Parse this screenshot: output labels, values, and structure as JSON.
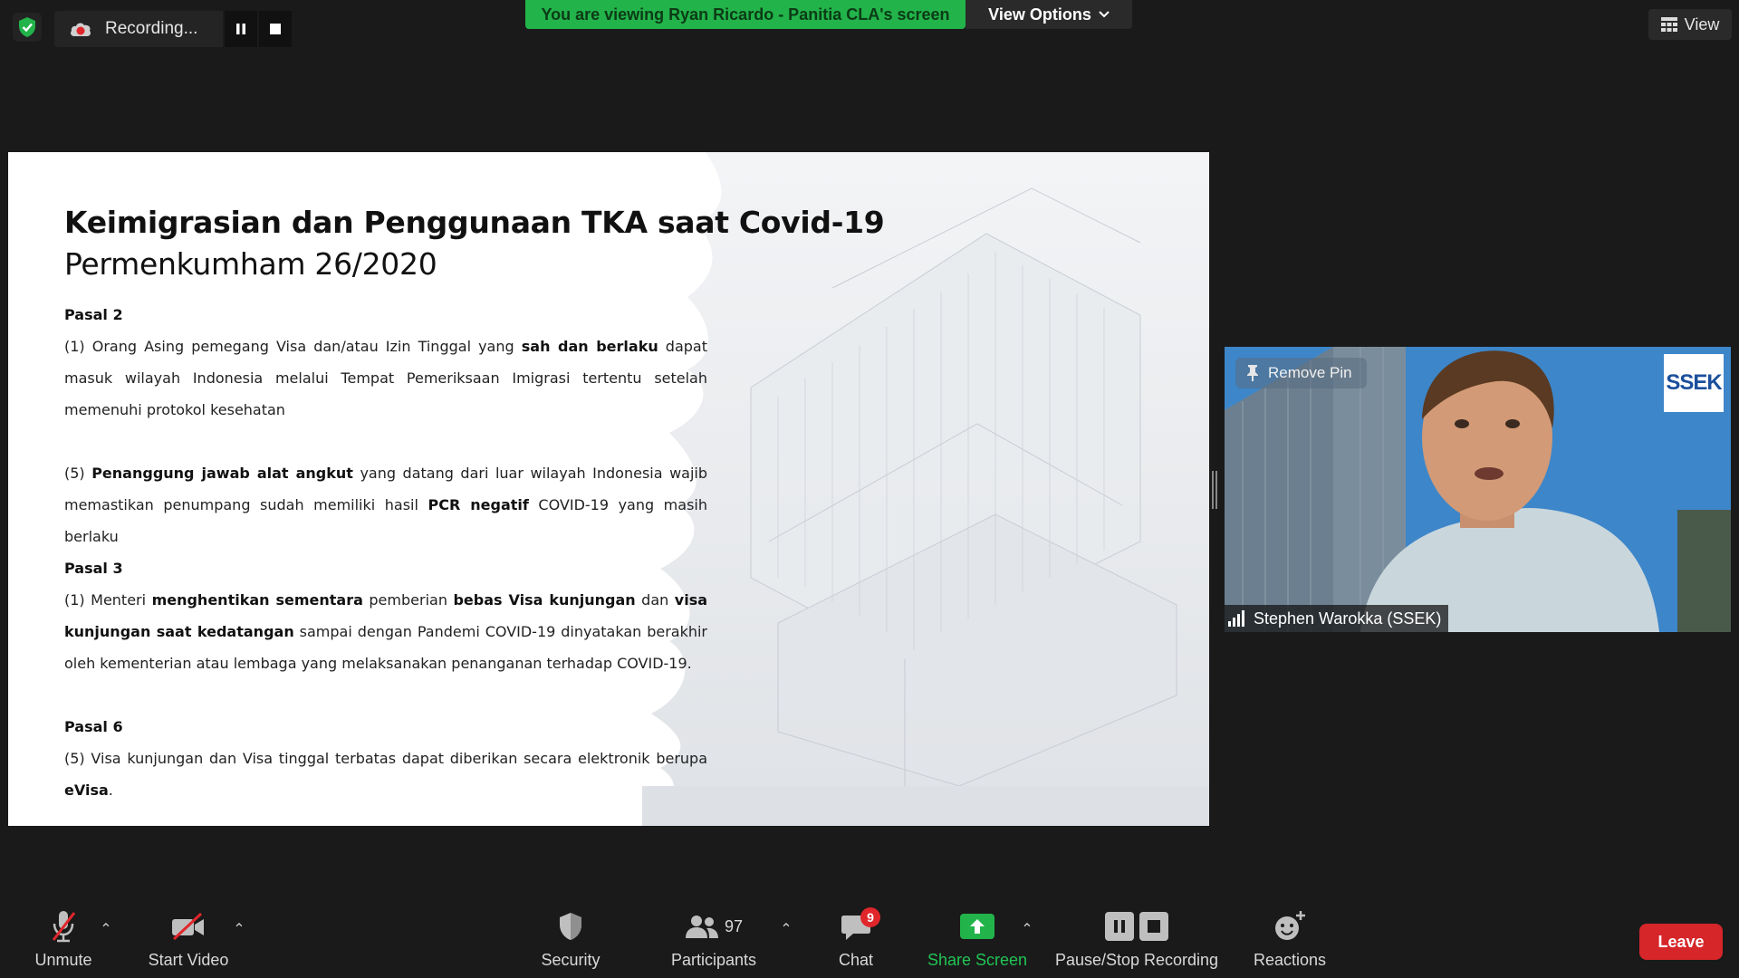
{
  "topbar": {
    "recording_label": "Recording...",
    "viewing_banner": "You are viewing Ryan Ricardo - Panitia CLA's screen",
    "view_options_label": "View Options",
    "view_label": "View"
  },
  "slide": {
    "title": "Keimigrasian dan Penggunaan TKA saat Covid-19",
    "subtitle": "Permenkumham 26/2020",
    "sections": [
      {
        "heading": "Pasal 2",
        "para1": {
          "t1": "(1) Orang Asing pemegang Visa dan/atau Izin Tinggal yang ",
          "b1": "sah dan berlaku",
          "t2": " dapat masuk wilayah Indonesia melalui Tempat Pemeriksaan Imigrasi tertentu setelah memenuhi protokol kesehatan"
        },
        "para2": {
          "t1": "(5) ",
          "b1": "Penanggung jawab alat angkut",
          "t2": " yang datang dari luar wilayah Indonesia wajib memastikan penumpang sudah memiliki hasil ",
          "b2": "PCR negatif",
          "t3": " COVID-19 yang masih berlaku"
        }
      },
      {
        "heading": "Pasal 3",
        "para1": {
          "t1": "(1) Menteri ",
          "b1": "menghentikan sementara",
          "t2": " pemberian ",
          "b2": "bebas Visa kunjungan",
          "t3": " dan ",
          "b3": "visa kunjungan saat kedatangan",
          "t4": " sampai dengan Pandemi COVID-19 dinyatakan berakhir oleh kementerian atau lembaga yang melaksanakan penanganan terhadap COVID-19."
        }
      },
      {
        "heading": "Pasal 6",
        "para1": {
          "t1": "(5) Visa kunjungan dan Visa tinggal terbatas dapat diberikan secara elektronik berupa ",
          "b1": "eVisa",
          "t2": "."
        }
      }
    ]
  },
  "video": {
    "remove_pin_label": "Remove Pin",
    "participant_name": "Stephen Warokka (SSEK)",
    "logo_text": "SSEK"
  },
  "toolbar": {
    "unmute_label": "Unmute",
    "start_video_label": "Start Video",
    "security_label": "Security",
    "participants_label": "Participants",
    "participants_count": "97",
    "chat_label": "Chat",
    "chat_badge": "9",
    "share_screen_label": "Share Screen",
    "pause_stop_label": "Pause/Stop Recording",
    "reactions_label": "Reactions",
    "leave_label": "Leave"
  },
  "colors": {
    "green_banner": "#22b34a",
    "leave_red": "#d6262a",
    "share_green": "#22b34a"
  },
  "icons": [
    "shield-check-icon",
    "recording-cloud-icon",
    "pause-icon",
    "stop-icon",
    "chevron-down-icon",
    "grid-view-icon",
    "pin-icon",
    "signal-bars-icon",
    "mic-muted-icon",
    "video-off-icon",
    "shield-icon",
    "participants-icon",
    "chat-icon",
    "share-screen-icon",
    "pause-stop-recording-icon",
    "reactions-icon",
    "caret-up-icon"
  ]
}
